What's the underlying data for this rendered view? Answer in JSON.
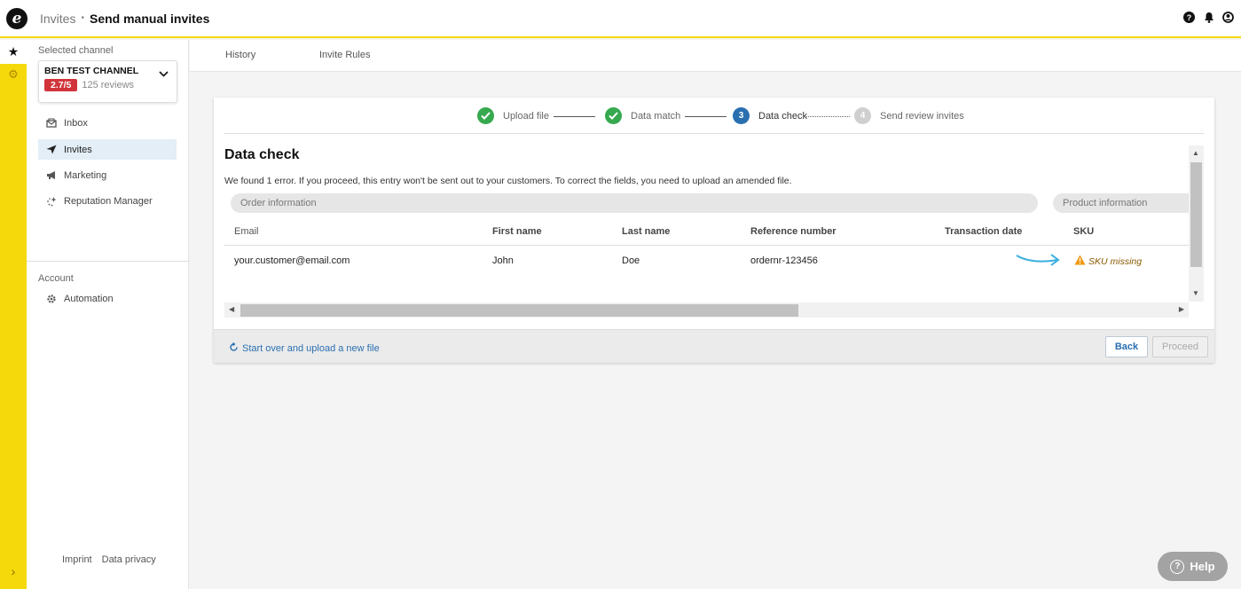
{
  "header": {
    "logo_letter": "e",
    "breadcrumb_parent": "Invites",
    "breadcrumb_separator": "•",
    "breadcrumb_current": "Send manual invites",
    "icons": [
      "help-circle-icon",
      "bell-icon",
      "user-circle-icon"
    ]
  },
  "rail": {
    "icons": [
      "star-icon",
      "gear-icon"
    ],
    "expand_glyph": "›"
  },
  "sidebar": {
    "channel_label": "Selected channel",
    "channel_name": "BEN TEST CHANNEL",
    "rating": "2.7/5",
    "reviews": "125 reviews",
    "items": [
      {
        "label": "Inbox",
        "icon": "inbox-icon"
      },
      {
        "label": "Invites",
        "icon": "send-icon",
        "selected": true
      },
      {
        "label": "Marketing",
        "icon": "megaphone-icon"
      },
      {
        "label": "Reputation Manager",
        "icon": "sparkle-icon"
      }
    ],
    "account_label": "Account",
    "account_items": [
      {
        "label": "Automation",
        "icon": "cog-robot-icon"
      }
    ],
    "footer_links": [
      "Imprint",
      "Data privacy"
    ]
  },
  "subnav": {
    "tabs": [
      "History",
      "Invite Rules"
    ]
  },
  "wizard": {
    "steps": [
      {
        "number": "1",
        "label": "Upload file",
        "status": "done"
      },
      {
        "number": "2",
        "label": "Data match",
        "status": "done"
      },
      {
        "number": "3",
        "label": "Data check",
        "status": "current"
      },
      {
        "number": "4",
        "label": "Send review invites",
        "status": "todo"
      }
    ]
  },
  "data_check": {
    "title": "Data check",
    "message": "We found 1 error. If you proceed, this entry won't be sent out to your customers. To correct the fields, you need to upload an amended file.",
    "groups": [
      "Order information",
      "Product information"
    ],
    "columns": [
      "Email",
      "First name",
      "Last name",
      "Reference number",
      "Transaction date",
      "SKU"
    ],
    "rows": [
      {
        "email": "your.customer@email.com",
        "first_name": "John",
        "last_name": "Doe",
        "reference": "ordernr-123456",
        "transaction_date": "",
        "sku_error": "SKU missing"
      }
    ]
  },
  "footer": {
    "start_over": "Start over and upload a new file",
    "back": "Back",
    "proceed": "Proceed"
  },
  "help": {
    "label": "Help"
  },
  "colors": {
    "brand_yellow": "#f5d90a",
    "accent_blue": "#2a6fb0",
    "success_green": "#36a94f",
    "rating_red": "#d1343a",
    "warning_orange": "#f0960a"
  }
}
